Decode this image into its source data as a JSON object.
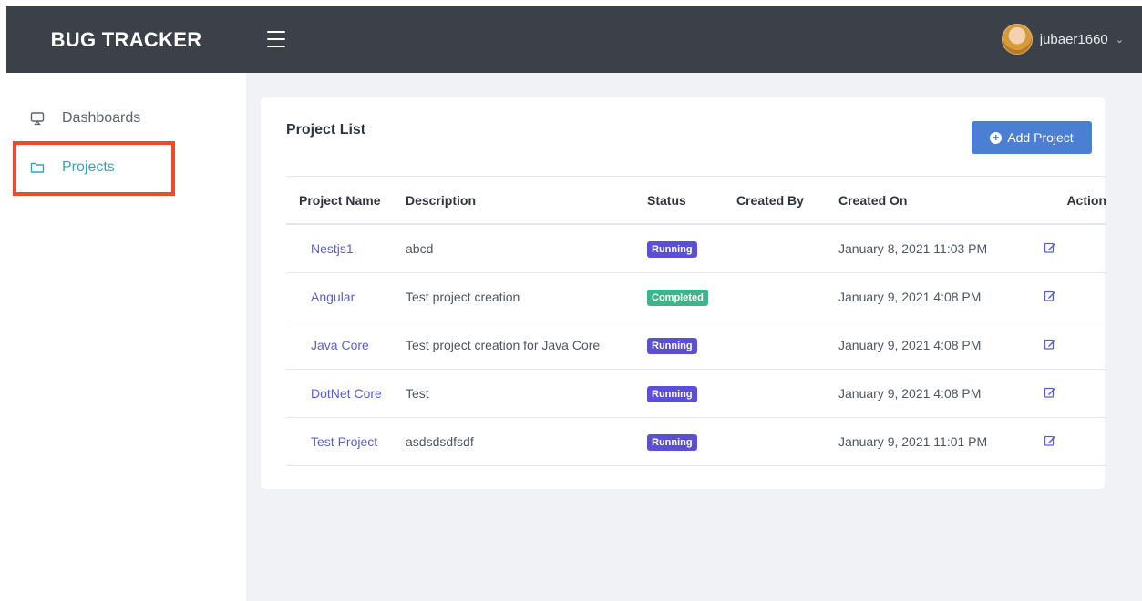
{
  "app": {
    "title": "BUG TRACKER"
  },
  "header": {
    "username": "jubaer1660",
    "caret": "⌄"
  },
  "sidebar": {
    "items": [
      {
        "label": "Dashboards",
        "icon": "monitor-icon"
      },
      {
        "label": "Projects",
        "icon": "folder-icon",
        "active": true
      }
    ]
  },
  "main": {
    "title": "Project List",
    "add_button": "Add Project",
    "columns": [
      "Project Name",
      "Description",
      "Status",
      "Created By",
      "Created On",
      "Action"
    ],
    "rows": [
      {
        "name": "Nestjs1",
        "description": "abcd",
        "status": "Running",
        "created_by": "",
        "created_on": "January 8, 2021 11:03 PM"
      },
      {
        "name": "Angular",
        "description": "Test project creation",
        "status": "Completed",
        "created_by": "",
        "created_on": "January 9, 2021 4:08 PM"
      },
      {
        "name": "Java Core",
        "description": "Test project creation for Java Core",
        "status": "Running",
        "created_by": "",
        "created_on": "January 9, 2021 4:08 PM"
      },
      {
        "name": "DotNet Core",
        "description": "Test",
        "status": "Running",
        "created_by": "",
        "created_on": "January 9, 2021 4:08 PM"
      },
      {
        "name": "Test Project",
        "description": "asdsdsdfsdf",
        "status": "Running",
        "created_by": "",
        "created_on": "January 9, 2021 11:01 PM"
      }
    ]
  },
  "colors": {
    "topbar": "#3c4049",
    "accent": "#4a7fd4",
    "running": "#5b4fd6",
    "completed": "#3fb38a",
    "active_nav": "#3aa3b8",
    "highlight": "#ef4a2f"
  }
}
